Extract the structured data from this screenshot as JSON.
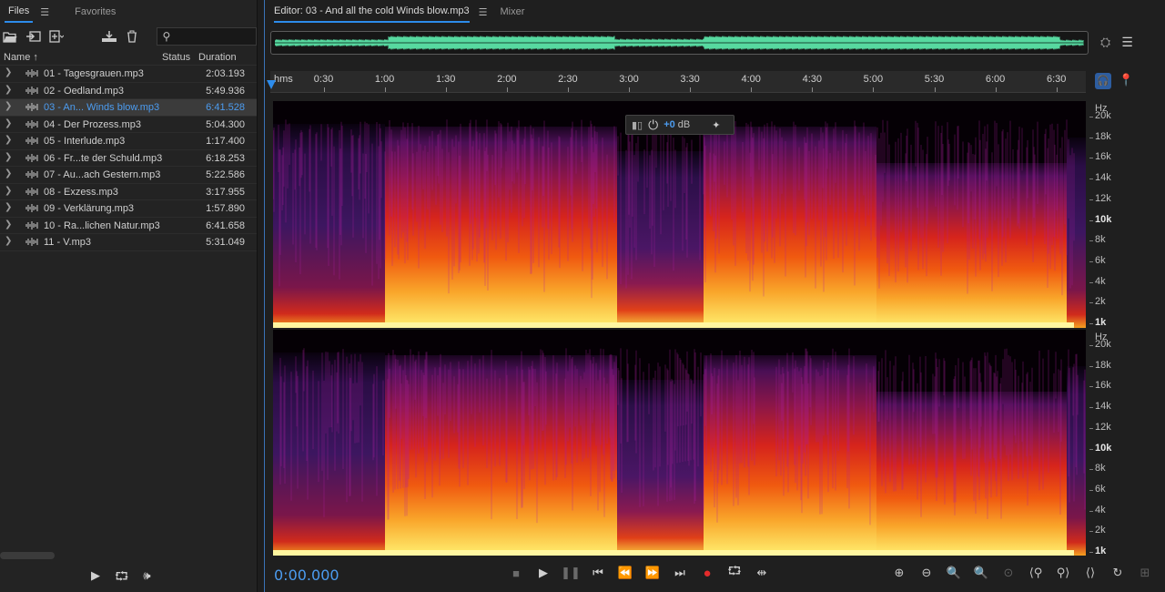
{
  "files_panel": {
    "tabs": [
      {
        "label": "Files",
        "active": true
      },
      {
        "label": "Favorites",
        "active": false
      }
    ],
    "search": {
      "placeholder": "",
      "icon": "search-icon"
    },
    "columns": {
      "name": "Name",
      "status": "Status",
      "duration": "Duration"
    },
    "files": [
      {
        "name": "01 - Tagesgrauen.mp3",
        "duration": "2:03.193",
        "selected": false
      },
      {
        "name": "02 - Oedland.mp3",
        "duration": "5:49.936",
        "selected": false
      },
      {
        "name": "03 - An... Winds blow.mp3",
        "duration": "6:41.528",
        "selected": true
      },
      {
        "name": "04 - Der Prozess.mp3",
        "duration": "5:04.300",
        "selected": false
      },
      {
        "name": "05 - Interlude.mp3",
        "duration": "1:17.400",
        "selected": false
      },
      {
        "name": "06 - Fr...te der Schuld.mp3",
        "duration": "6:18.253",
        "selected": false
      },
      {
        "name": "07 - Au...ach Gestern.mp3",
        "duration": "5:22.586",
        "selected": false
      },
      {
        "name": "08 - Exzess.mp3",
        "duration": "3:17.955",
        "selected": false
      },
      {
        "name": "09 - Verklärung.mp3",
        "duration": "1:57.890",
        "selected": false
      },
      {
        "name": "10 - Ra...lichen Natur.mp3",
        "duration": "6:41.658",
        "selected": false
      },
      {
        "name": "11 - V.mp3",
        "duration": "5:31.049",
        "selected": false
      }
    ]
  },
  "editor": {
    "tabs": [
      {
        "label": "Editor: 03 - And all the cold Winds blow.mp3",
        "active": true
      },
      {
        "label": "Mixer",
        "active": false
      }
    ],
    "ruler": {
      "labels": [
        "hms",
        "0:30",
        "1:00",
        "1:30",
        "2:00",
        "2:30",
        "3:00",
        "3:30",
        "4:00",
        "4:30",
        "5:00",
        "5:30",
        "6:00",
        "6:30"
      ]
    },
    "hud": {
      "gain": "+0",
      "unit": "dB"
    },
    "freq_axis": {
      "unit": "Hz",
      "labels": [
        "20k",
        "18k",
        "16k",
        "14k",
        "12k",
        "10k",
        "8k",
        "6k",
        "4k",
        "2k",
        "1k"
      ]
    },
    "time_display": "0:00.000",
    "accent_color": "#2d8ceb",
    "waveform_color": "#57d9a0"
  }
}
